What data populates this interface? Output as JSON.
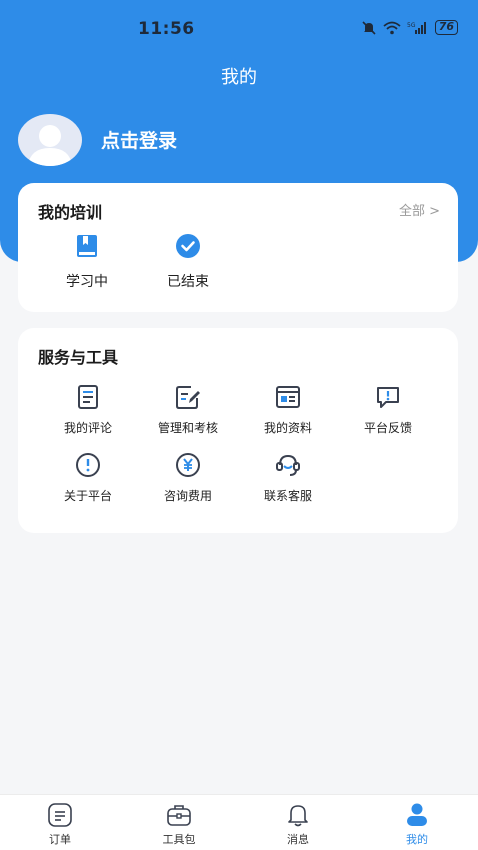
{
  "status_bar": {
    "time": "11:56",
    "battery": "76"
  },
  "header": {
    "title": "我的",
    "login_text": "点击登录"
  },
  "training": {
    "title": "我的培训",
    "all_label": "全部 >",
    "items": [
      {
        "label": "学习中",
        "icon": "book-icon"
      },
      {
        "label": "已结束",
        "icon": "check-circle-icon"
      }
    ]
  },
  "services": {
    "title": "服务与工具",
    "items": [
      {
        "label": "我的评论",
        "icon": "document-icon"
      },
      {
        "label": "管理和考核",
        "icon": "edit-icon"
      },
      {
        "label": "我的资料",
        "icon": "profile-card-icon"
      },
      {
        "label": "平台反馈",
        "icon": "feedback-icon"
      },
      {
        "label": "关于平台",
        "icon": "info-icon"
      },
      {
        "label": "咨询费用",
        "icon": "yen-icon"
      },
      {
        "label": "联系客服",
        "icon": "headset-icon"
      }
    ]
  },
  "tabbar": {
    "tabs": [
      {
        "label": "订单",
        "icon": "order-icon",
        "active": false
      },
      {
        "label": "工具包",
        "icon": "toolkit-icon",
        "active": false
      },
      {
        "label": "消息",
        "icon": "bell-icon",
        "active": false
      },
      {
        "label": "我的",
        "icon": "user-icon",
        "active": true
      }
    ]
  },
  "colors": {
    "accent": "#2e8ce8",
    "icon_dark": "#3a4150"
  }
}
